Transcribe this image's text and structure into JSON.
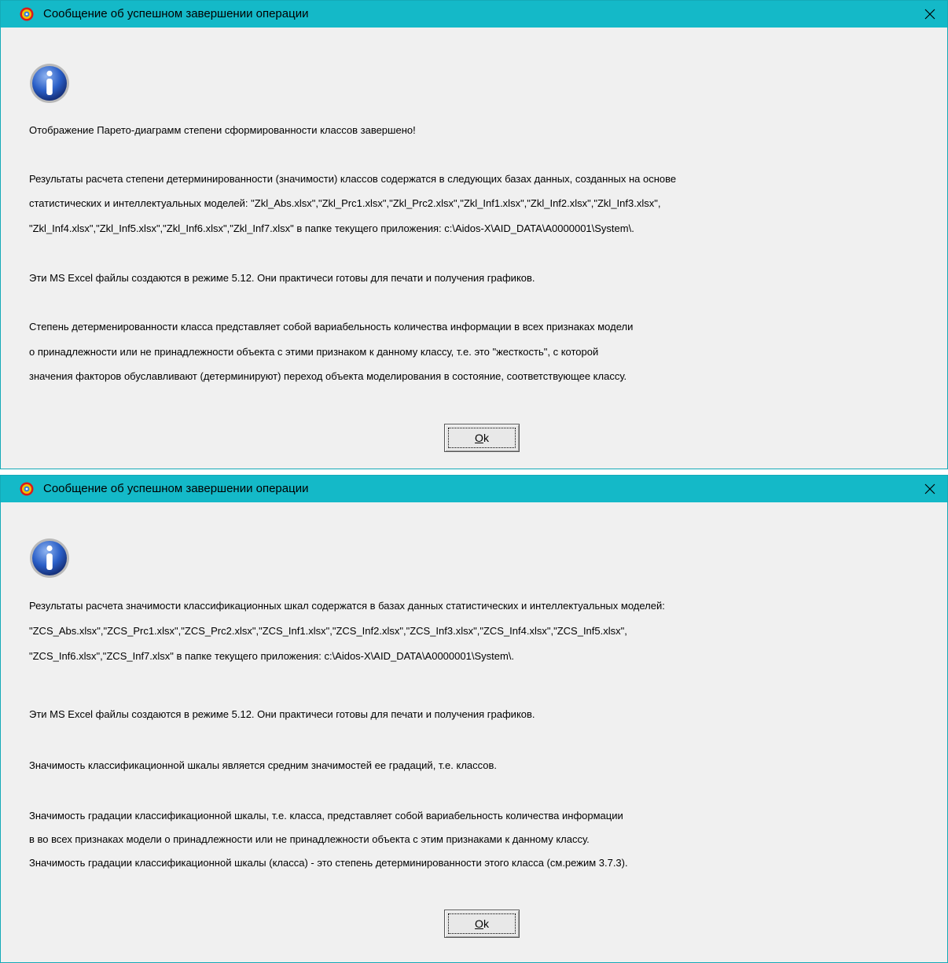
{
  "dialogs": [
    {
      "title": "Сообщение об успешном завершении операции",
      "lines": [
        "Отображение Парето-диаграмм степени сформированности классов завершено!",
        "Результаты расчета степени детерминированности (значимости) классов содержатся в следующих базах данных, созданных на основе",
        "статистических и интеллектуальных моделей: \"Zkl_Abs.xlsx\",\"Zkl_Prc1.xlsx\",\"Zkl_Prc2.xlsx\",\"Zkl_Inf1.xlsx\",\"Zkl_Inf2.xlsx\",\"Zkl_Inf3.xlsx\",",
        "\"Zkl_Inf4.xlsx\",\"Zkl_Inf5.xlsx\",\"Zkl_Inf6.xlsx\",\"Zkl_Inf7.xlsx\" в папке текущего приложения: c:\\Aidos-X\\AID_DATA\\A0000001\\System\\.",
        "Эти MS Excel файлы создаются в режиме 5.12. Они практичеси готовы для печати и получения графиков.",
        "Степень детерменированности класса представляет собой вариабельность количества информации в всех признаках модели",
        "о принадлежности или не принадлежности объекта с этими признаком к данному классу, т.е. это \"жесткость\", с которой",
        "значения факторов обуславливают (детерминируют) переход объекта моделирования в состояние, соответствующее классу."
      ],
      "ok_mnemonic": "O",
      "ok_rest": "k"
    },
    {
      "title": "Сообщение об успешном завершении операции",
      "lines": [
        "Результаты расчета значимости классификационных шкал содержатся в базах данных статистических и интеллектуальных моделей:",
        "\"ZCS_Abs.xlsx\",\"ZCS_Prc1.xlsx\",\"ZCS_Prc2.xlsx\",\"ZCS_Inf1.xlsx\",\"ZCS_Inf2.xlsx\",\"ZCS_Inf3.xlsx\",\"ZCS_Inf4.xlsx\",\"ZCS_Inf5.xlsx\",",
        "\"ZCS_Inf6.xlsx\",\"ZCS_Inf7.xlsx\" в папке текущего приложения: c:\\Aidos-X\\AID_DATA\\A0000001\\System\\.",
        "Эти MS Excel файлы создаются в режиме 5.12. Они практичеси готовы для печати и получения графиков.",
        "Значимость классификационной шкалы является средним значимостей ее градаций, т.е. классов.",
        "Значимость градации классификационной шкалы, т.е. класса, представляет собой вариабельность количества информации",
        "в во всех признаках модели о принадлежности или не принадлежности объекта с этим признаками к данному классу.",
        "Значимость градации классификационной шкалы (класса) - это степень детерминированности этого класса (см.режим 3.7.3)."
      ],
      "ok_mnemonic": "O",
      "ok_rest": "k"
    }
  ],
  "colors": {
    "titlebar": "#14b9c8",
    "dialog_bg": "#f0f0f0",
    "border": "#14aab8"
  },
  "icons": {
    "app": "aidos-app-icon",
    "info": "info-icon",
    "close": "close-icon"
  }
}
